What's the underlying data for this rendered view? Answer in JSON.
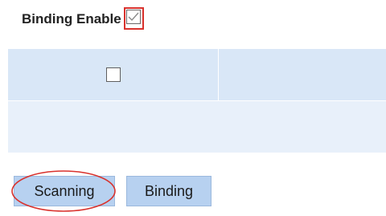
{
  "binding_enable": {
    "label": "Binding Enable",
    "checked": true
  },
  "table": {
    "rows": [
      {
        "checkbox": false,
        "value": ""
      },
      {
        "value": ""
      }
    ]
  },
  "buttons": {
    "scanning_label": "Scanning",
    "binding_label": "Binding"
  },
  "colors": {
    "header_row": "#d9e7f7",
    "second_row": "#e8f0fa",
    "button_bg": "#b7d1f0",
    "annotation_red": "#d9322d"
  }
}
